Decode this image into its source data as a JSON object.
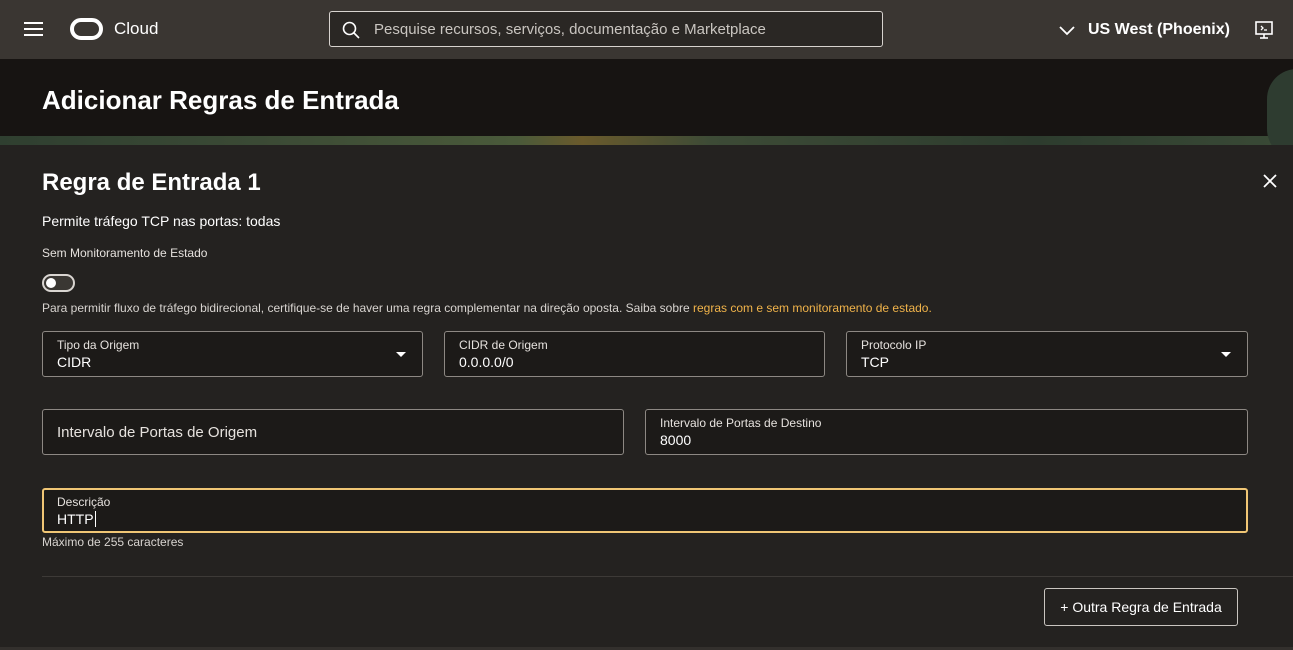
{
  "topbar": {
    "brand": "Cloud",
    "search_placeholder": "Pesquise recursos, serviços, documentação e Marketplace",
    "region": "US West (Phoenix)"
  },
  "page": {
    "title": "Adicionar Regras de Entrada"
  },
  "rule": {
    "title": "Regra de Entrada 1",
    "summary": "Permite tráfego TCP nas portas: todas",
    "stateless_label": "Sem Monitoramento de Estado",
    "stateless_enabled": false,
    "helper_text": "Para permitir fluxo de tráfego bidirecional, certifique-se de haver uma regra complementar na direção oposta. Saiba sobre ",
    "helper_link": "regras com e sem monitoramento de estado.",
    "source_type_label": "Tipo da Origem",
    "source_type_value": "CIDR",
    "source_cidr_label": "CIDR de Origem",
    "source_cidr_value": "0.0.0.0/0",
    "protocol_label": "Protocolo IP",
    "protocol_value": "TCP",
    "source_port_placeholder": "Intervalo de Portas de Origem",
    "dest_port_label": "Intervalo de Portas de Destino",
    "dest_port_value": "8000",
    "description_label": "Descrição",
    "description_value": "HTTP",
    "max_chars": "Máximo de 255 caracteres"
  },
  "actions": {
    "add_rule": "+ Outra Regra de Entrada"
  },
  "colors": {
    "link": "#f0b34a",
    "focus_border": "#f0c675",
    "topbar_bg": "#3a3632",
    "panel_bg": "#242220"
  }
}
